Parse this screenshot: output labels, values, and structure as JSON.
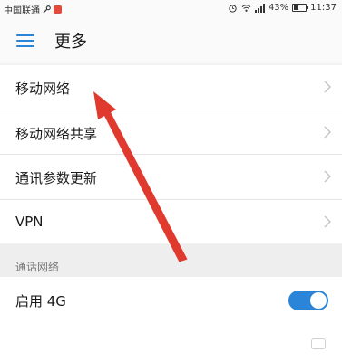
{
  "status_bar": {
    "carrier": "中国联通",
    "battery": "43%",
    "time": "11:37",
    "battery_level": 0.43,
    "icons": [
      "key-icon",
      "notification-badge-icon",
      "alarm-icon",
      "wifi-icon",
      "signal-icon",
      "battery-icon"
    ]
  },
  "header": {
    "menu_icon": "hamburger-menu-icon",
    "title": "更多"
  },
  "list": {
    "items": [
      {
        "label": "移动网络"
      },
      {
        "label": "移动网络共享"
      },
      {
        "label": "通讯参数更新"
      },
      {
        "label": "VPN"
      }
    ]
  },
  "section": {
    "title": "通话网络"
  },
  "toggle_row": {
    "label": "启用 4G",
    "enabled": true
  },
  "annotation": {
    "arrow_color": "#e03a2f",
    "points_to": "移动网络"
  },
  "colors": {
    "accent": "#2a84d8",
    "background": "#f2f2f2"
  }
}
